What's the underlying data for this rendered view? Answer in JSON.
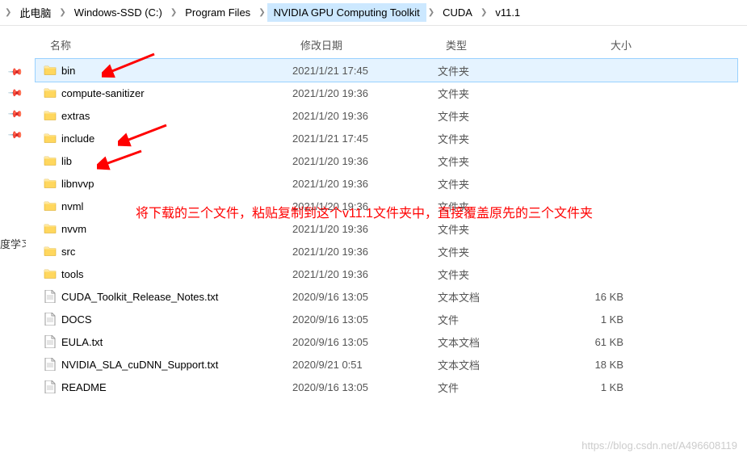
{
  "breadcrumb": {
    "items": [
      {
        "label": "此电脑",
        "highlighted": false
      },
      {
        "label": "Windows-SSD (C:)",
        "highlighted": false
      },
      {
        "label": "Program Files",
        "highlighted": false
      },
      {
        "label": "NVIDIA GPU Computing Toolkit",
        "highlighted": true
      },
      {
        "label": "CUDA",
        "highlighted": false
      },
      {
        "label": "v11.1",
        "highlighted": false
      }
    ]
  },
  "left_text": "度学习",
  "columns": {
    "name": "名称",
    "date": "修改日期",
    "type": "类型",
    "size": "大小"
  },
  "rows": [
    {
      "icon": "folder",
      "name": "bin",
      "date": "2021/1/21 17:45",
      "type": "文件夹",
      "size": "",
      "selected": true
    },
    {
      "icon": "folder",
      "name": "compute-sanitizer",
      "date": "2021/1/20 19:36",
      "type": "文件夹",
      "size": "",
      "selected": false
    },
    {
      "icon": "folder",
      "name": "extras",
      "date": "2021/1/20 19:36",
      "type": "文件夹",
      "size": "",
      "selected": false
    },
    {
      "icon": "folder",
      "name": "include",
      "date": "2021/1/21 17:45",
      "type": "文件夹",
      "size": "",
      "selected": false
    },
    {
      "icon": "folder",
      "name": "lib",
      "date": "2021/1/20 19:36",
      "type": "文件夹",
      "size": "",
      "selected": false
    },
    {
      "icon": "folder",
      "name": "libnvvp",
      "date": "2021/1/20 19:36",
      "type": "文件夹",
      "size": "",
      "selected": false
    },
    {
      "icon": "folder",
      "name": "nvml",
      "date": "2021/1/20 19:36",
      "type": "文件夹",
      "size": "",
      "selected": false
    },
    {
      "icon": "folder",
      "name": "nvvm",
      "date": "2021/1/20 19:36",
      "type": "文件夹",
      "size": "",
      "selected": false
    },
    {
      "icon": "folder",
      "name": "src",
      "date": "2021/1/20 19:36",
      "type": "文件夹",
      "size": "",
      "selected": false
    },
    {
      "icon": "folder",
      "name": "tools",
      "date": "2021/1/20 19:36",
      "type": "文件夹",
      "size": "",
      "selected": false
    },
    {
      "icon": "file",
      "name": "CUDA_Toolkit_Release_Notes.txt",
      "date": "2020/9/16 13:05",
      "type": "文本文档",
      "size": "16 KB",
      "selected": false
    },
    {
      "icon": "file",
      "name": "DOCS",
      "date": "2020/9/16 13:05",
      "type": "文件",
      "size": "1 KB",
      "selected": false
    },
    {
      "icon": "file",
      "name": "EULA.txt",
      "date": "2020/9/16 13:05",
      "type": "文本文档",
      "size": "61 KB",
      "selected": false
    },
    {
      "icon": "file",
      "name": "NVIDIA_SLA_cuDNN_Support.txt",
      "date": "2020/9/21 0:51",
      "type": "文本文档",
      "size": "18 KB",
      "selected": false
    },
    {
      "icon": "file",
      "name": "README",
      "date": "2020/9/16 13:05",
      "type": "文件",
      "size": "1 KB",
      "selected": false
    }
  ],
  "annotation": {
    "text": "将下载的三个文件，粘贴复制到这个v11.1文件夹中，直接覆盖原先的三个文件夹"
  },
  "watermark": "https://blog.csdn.net/A496608119"
}
